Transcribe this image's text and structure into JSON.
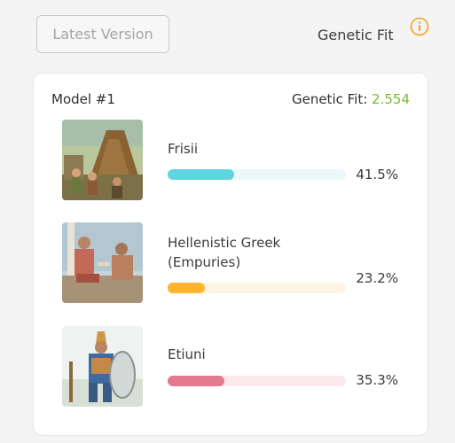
{
  "header": {
    "latest_version_label": "Latest Version",
    "genetic_fit_label": "Genetic Fit"
  },
  "model": {
    "title": "Model #1",
    "fit_label": "Genetic Fit:",
    "fit_value": "2.554"
  },
  "populations": [
    {
      "name": "Frisii",
      "percent_text": "41.5%",
      "fraction": 0.415,
      "color": "#5fd4e0",
      "track": "#eaf8fa"
    },
    {
      "name_line1": "Hellenistic Greek",
      "name_line2": "(Empuries)",
      "percent_text": "23.2%",
      "fraction": 0.232,
      "color": "#fdb52f",
      "track": "#fdf3e3"
    },
    {
      "name": "Etiuni",
      "percent_text": "35.3%",
      "fraction": 0.353,
      "color": "#e27a90",
      "track": "#fbe9ed"
    }
  ],
  "colors": {
    "fit_value": "#7ab830",
    "info_icon": "#f4a31a"
  }
}
